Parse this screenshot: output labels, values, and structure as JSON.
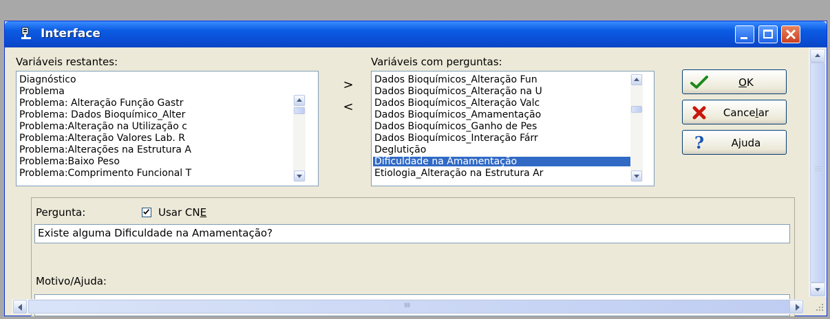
{
  "window": {
    "title": "Interface",
    "colors": {
      "titlebar": "#0a4fd6",
      "selection": "#316ac5",
      "face": "#ece9d8"
    }
  },
  "left_list": {
    "label": "Variáveis restantes:",
    "items": [
      "Diagnóstico",
      "Problema",
      "Problema: Alteração Função Gastr",
      "Problema: Dados Bioquímico_Alter",
      "Problema:Alteração na Utilização c",
      "Problema:Alteração Valores Lab. R",
      "Problema:Alterações na Estrutura A",
      "Problema:Baixo Peso",
      "Problema:Comprimento Funcional T"
    ]
  },
  "movers": {
    "add": ">",
    "remove": "<"
  },
  "right_list": {
    "label": "Variáveis com perguntas:",
    "items": [
      "Dados Bioquímicos_Alteração Fun",
      "Dados Bioquímicos_Alteração na U",
      "Dados Bioquímicos_Alteração Valc",
      "Dados Bioquímicos_Amamentação",
      "Dados Bioquímicos_Ganho de Pes",
      "Dados Bioquímicos_Interação Fárr",
      "Deglutição",
      "Dificuldade na Amamentação",
      "Etiologia_Alteração na Estrutura Ar"
    ],
    "selected_index": 7
  },
  "buttons": {
    "ok": {
      "label": "OK",
      "icon": "checkmark-icon"
    },
    "cancel": {
      "label": "Cancelar",
      "icon": "red-x-icon"
    },
    "help": {
      "label": "Ajuda",
      "icon": "question-mark-icon"
    }
  },
  "question": {
    "label": "Pergunta:",
    "checkbox_label": "Usar CNE",
    "checked": true,
    "value": "Existe alguma Dificuldade na Amamentação?"
  },
  "reason": {
    "label": "Motivo/Ajuda:",
    "value": ""
  },
  "scrollbar": {
    "grip": "IIIII"
  }
}
